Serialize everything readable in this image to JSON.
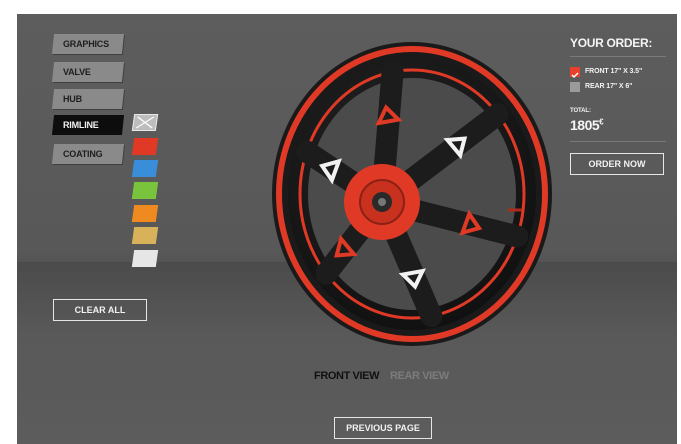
{
  "menu": {
    "items": [
      {
        "label": "GRAPHICS",
        "active": false
      },
      {
        "label": "VALVE",
        "active": false
      },
      {
        "label": "HUB",
        "active": false
      },
      {
        "label": "RIMLINE",
        "active": true
      },
      {
        "label": "COATING",
        "active": false
      }
    ]
  },
  "swatches": [
    {
      "name": "none",
      "color": "#bdbdbd",
      "icon": "cross-icon"
    },
    {
      "name": "red",
      "color": "#e03a26"
    },
    {
      "name": "blue",
      "color": "#3a8dd8"
    },
    {
      "name": "green",
      "color": "#79c43c"
    },
    {
      "name": "orange",
      "color": "#ee8a20"
    },
    {
      "name": "gold",
      "color": "#d8b25a"
    },
    {
      "name": "white",
      "color": "#e6e6e6"
    }
  ],
  "actions": {
    "clear_all": "CLEAR ALL",
    "previous_page": "PREVIOUS PAGE"
  },
  "order": {
    "title": "YOUR ORDER:",
    "options": [
      {
        "label": "FRONT 17\" X 3.5\"",
        "checked": true
      },
      {
        "label": "REAR 17\" X 6\"",
        "checked": false
      }
    ],
    "total_label": "TOTAL:",
    "total_value": "1805",
    "currency": "€",
    "order_now": "ORDER NOW"
  },
  "views": {
    "front": "FRONT VIEW",
    "rear": "REAR VIEW",
    "active": "front"
  },
  "colors": {
    "accent_red": "#e03a26",
    "check_red": "#e8402a"
  }
}
